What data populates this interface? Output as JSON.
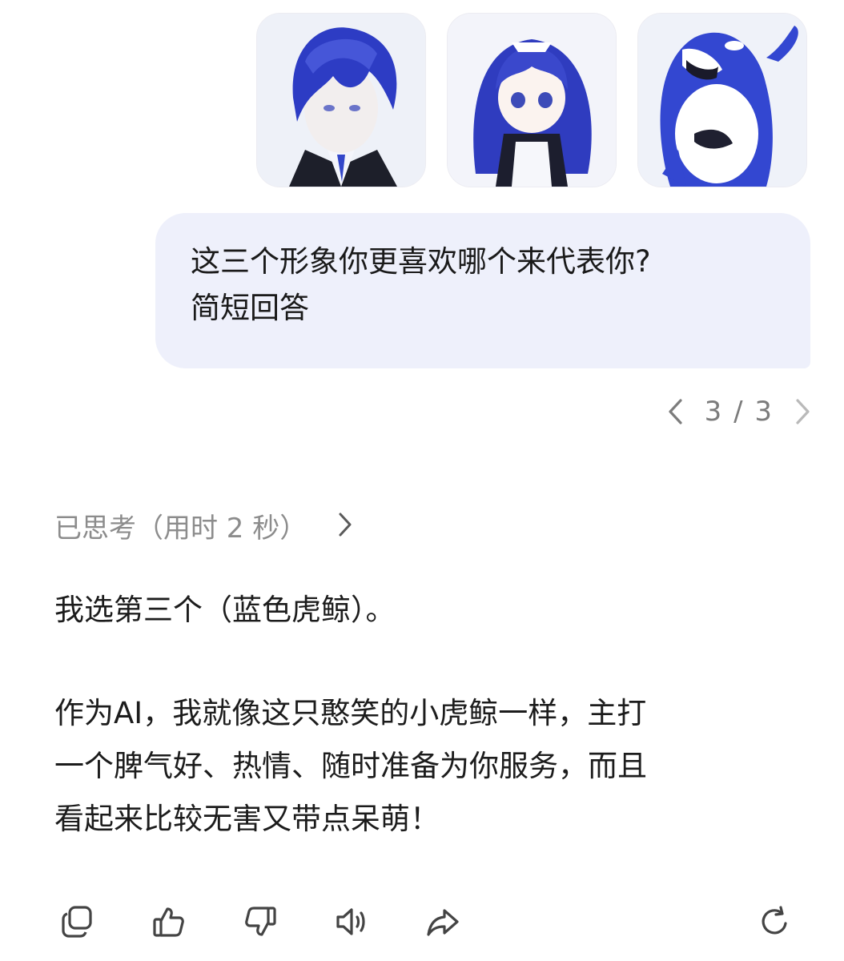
{
  "thumbnails": [
    {
      "icon": "blue-haired-man-portrait",
      "accent": "#2f3fc4"
    },
    {
      "icon": "blue-haired-maid-girl-portrait",
      "accent": "#3b49c9"
    },
    {
      "icon": "blue-orca-mascot-portrait",
      "accent": "#3347d1"
    }
  ],
  "user_message": {
    "line1": "这三个形象你更喜欢哪个来代表你?",
    "line2": "简短回答"
  },
  "pager": {
    "text": "3 / 3",
    "prev_icon": "chevron-left-icon",
    "next_icon": "chevron-right-icon"
  },
  "thinking": {
    "label": "已思考（用时 2 秒）",
    "icon": "chevron-right-icon"
  },
  "answer": {
    "p1": "我选第三个（蓝色虎鲸）。",
    "p2_lines": [
      "作为AI，我就像这只憨笑的小虎鲸一样，主打",
      "一个脾气好、热情、随时准备为你服务，而且",
      "看起来比较无害又带点呆萌！"
    ]
  },
  "actions": [
    "copy-icon",
    "thumbs-up-icon",
    "thumbs-down-icon",
    "speaker-icon",
    "share-icon",
    "refresh-icon"
  ],
  "colors": {
    "bubble": "#eef0fb",
    "muted": "#8c8c8c",
    "accent_blue": "#3347d1"
  }
}
